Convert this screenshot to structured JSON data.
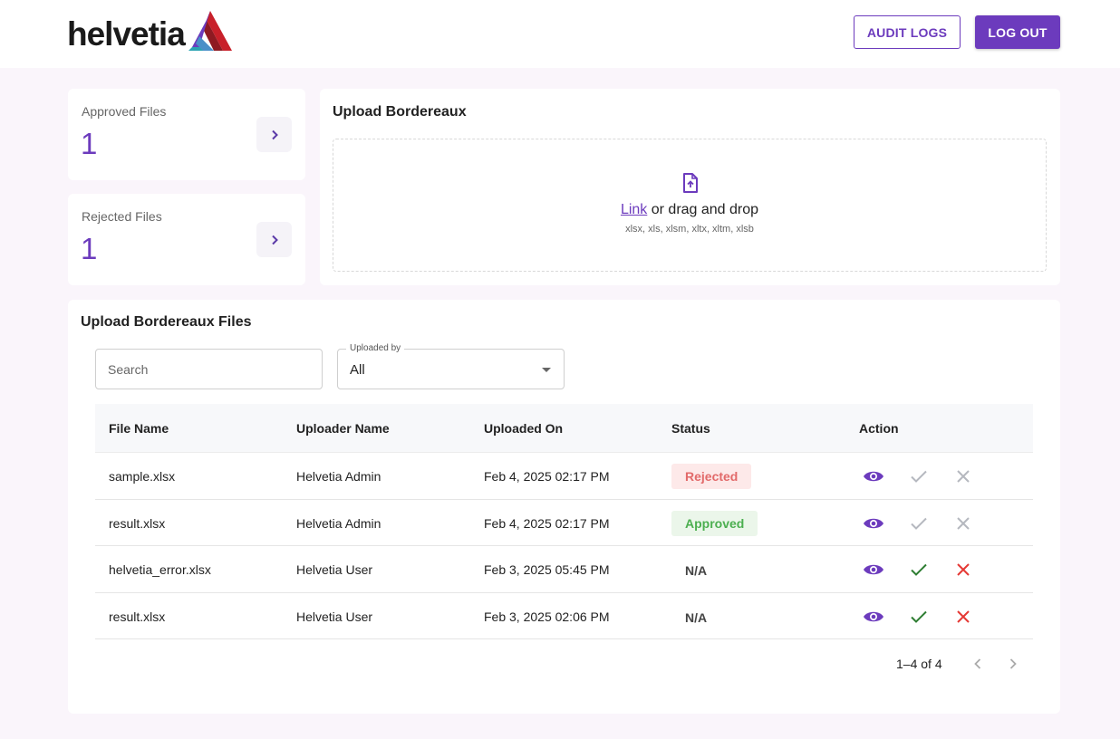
{
  "brand": {
    "name": "helvetia",
    "accent": "#6c3bbd"
  },
  "header": {
    "audit_logs_label": "AUDIT LOGS",
    "logout_label": "LOG OUT"
  },
  "stats": {
    "approved": {
      "label": "Approved Files",
      "value": "1"
    },
    "rejected": {
      "label": "Rejected Files",
      "value": "1"
    }
  },
  "upload": {
    "title": "Upload Bordereaux",
    "link_label": "Link",
    "drop_text": " or drag and drop",
    "formats": "xlsx, xls, xlsm, xltx, xltm, xlsb"
  },
  "files": {
    "title": "Upload Bordereaux Files",
    "search_placeholder": "Search",
    "filter": {
      "legend": "Uploaded by",
      "value": "All"
    },
    "columns": [
      "File Name",
      "Uploader Name",
      "Uploaded On",
      "Status",
      "Action"
    ],
    "rows": [
      {
        "file": "sample.xlsx",
        "uploader": "Helvetia Admin",
        "date": "Feb 4, 2025 02:17 PM",
        "status": "Rejected"
      },
      {
        "file": "result.xlsx",
        "uploader": "Helvetia Admin",
        "date": "Feb 4, 2025 02:17 PM",
        "status": "Approved"
      },
      {
        "file": "helvetia_error.xlsx",
        "uploader": "Helvetia User",
        "date": "Feb 3, 2025 05:45 PM",
        "status": "N/A"
      },
      {
        "file": "result.xlsx",
        "uploader": "Helvetia User",
        "date": "Feb 3, 2025 02:06 PM",
        "status": "N/A"
      }
    ],
    "pagination": {
      "range": "1–4 of 4"
    }
  }
}
